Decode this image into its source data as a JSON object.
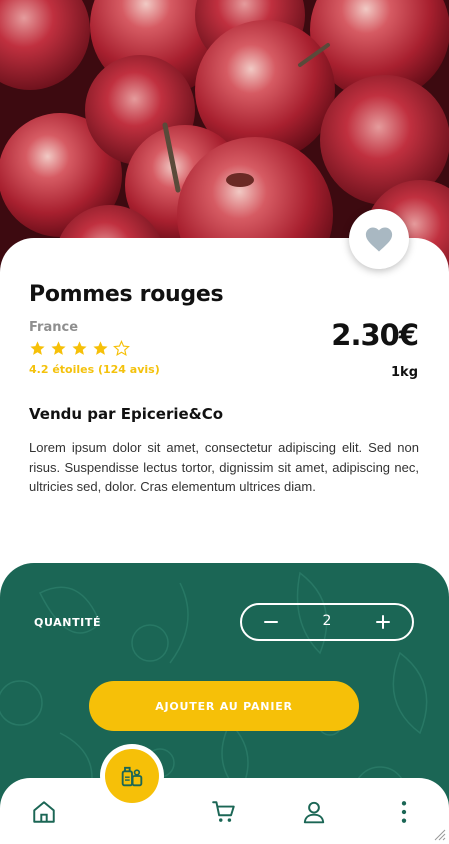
{
  "product": {
    "name": "Pommes rouges",
    "origin": "France",
    "rating_value": 4,
    "rating_max": 5,
    "rating_text": "4.2 étoiles (124 avis)",
    "price": "2.30€",
    "unit": "1kg",
    "seller": "Vendu par Epicerie&Co",
    "description": "Lorem ipsum dolor sit amet, consectetur adipiscing elit. Sed non risus. Suspendisse lectus tortor, dignissim sit amet, adipiscing nec, ultricies sed, dolor. Cras elementum ultrices diam."
  },
  "quantity": {
    "label": "QUANTITÉ",
    "value": "2"
  },
  "add_to_cart_label": "AJOUTER AU PANIER",
  "nav": {
    "items": [
      "home-icon",
      "cart-icon",
      "user-icon",
      "more-icon"
    ],
    "center": "grocery-icon"
  },
  "colors": {
    "accent": "#f6c008",
    "panel": "#1b6655",
    "favorite_heart": "#a9b8c2"
  }
}
